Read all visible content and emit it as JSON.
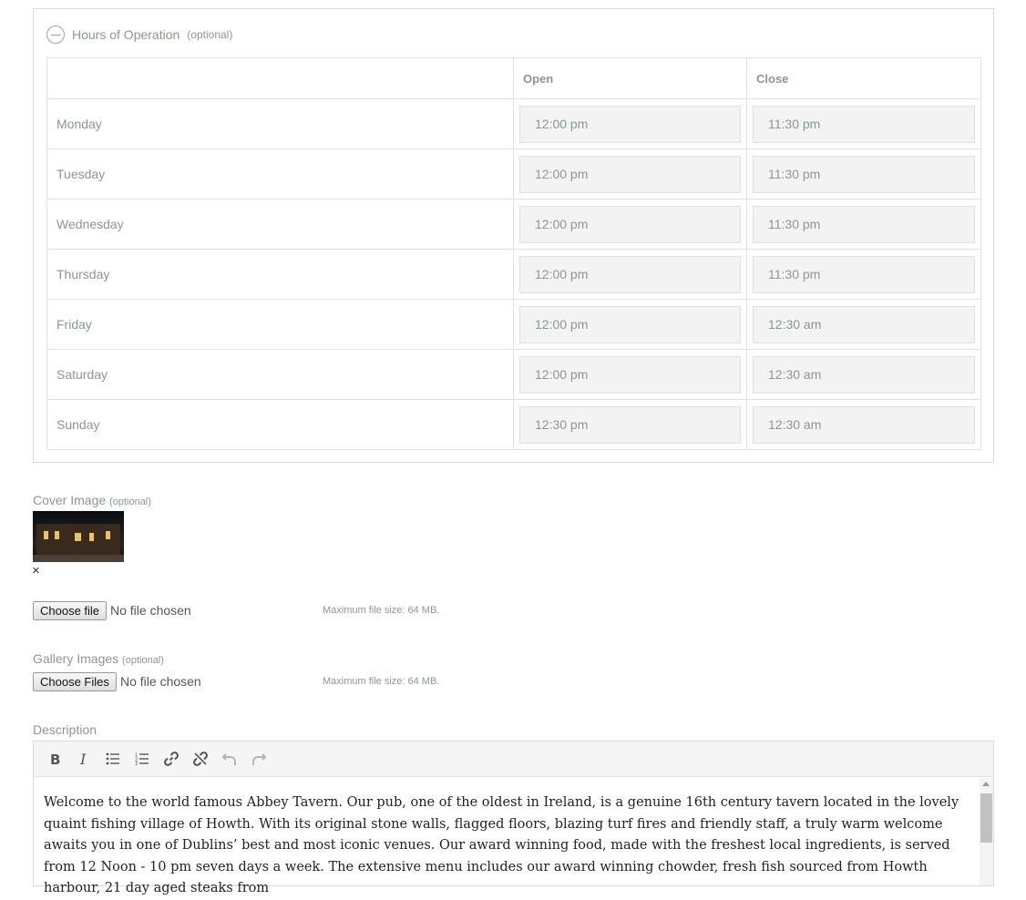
{
  "hours": {
    "title": "Hours of Operation",
    "optional": "(optional)",
    "col_open": "Open",
    "col_close": "Close",
    "rows": [
      {
        "day": "Monday",
        "open": "12:00 pm",
        "close": "11:30 pm"
      },
      {
        "day": "Tuesday",
        "open": "12:00 pm",
        "close": "11:30 pm"
      },
      {
        "day": "Wednesday",
        "open": "12:00 pm",
        "close": "11:30 pm"
      },
      {
        "day": "Thursday",
        "open": "12:00 pm",
        "close": "11:30 pm"
      },
      {
        "day": "Friday",
        "open": "12:00 pm",
        "close": "12:30 am"
      },
      {
        "day": "Saturday",
        "open": "12:00 pm",
        "close": "12:30 am"
      },
      {
        "day": "Sunday",
        "open": "12:30 pm",
        "close": "12:30 am"
      }
    ]
  },
  "cover": {
    "label": "Cover Image",
    "optional": "(optional)",
    "remove": "×",
    "button": "Choose file",
    "status": "No file chosen",
    "max": "Maximum file size: 64 MB."
  },
  "gallery": {
    "label": "Gallery Images",
    "optional": "(optional)",
    "button": "Choose Files",
    "status": "No file chosen",
    "max": "Maximum file size: 64 MB."
  },
  "description": {
    "label": "Description",
    "toolbar": [
      "bold-icon",
      "italic-icon",
      "bullet-list-icon",
      "numbered-list-icon",
      "link-icon",
      "unlink-icon",
      "undo-icon",
      "redo-icon"
    ],
    "text": "Welcome to the world famous Abbey Tavern. Our pub, one of the oldest in Ireland, is a genuine 16th century tavern located in the lovely quaint fishing village of Howth. With its original stone walls, flagged floors, blazing turf fires and friendly staff, a truly warm welcome awaits you in one of Dublins’ best and most iconic venues. Our award winning food, made with the freshest local ingredients, is served from 12 Noon - 10 pm seven days a week. The extensive menu includes our award winning chowder, fresh fish sourced from Howth harbour, 21 day aged steaks from"
  }
}
